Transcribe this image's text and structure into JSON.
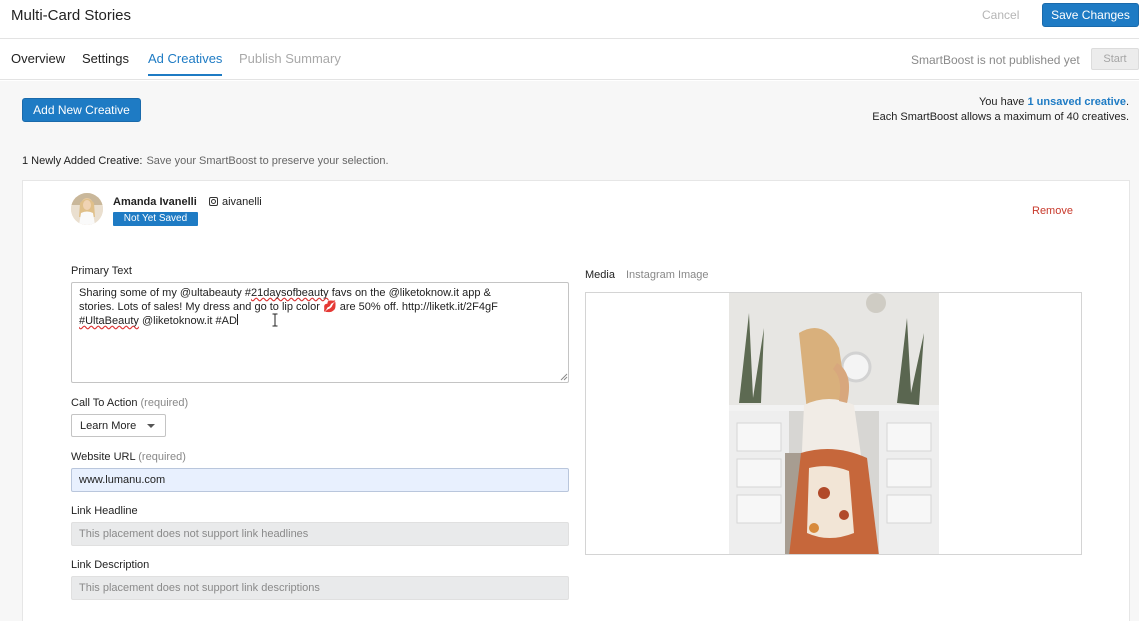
{
  "header": {
    "title": "Multi-Card Stories",
    "cancel_label": "Cancel",
    "save_label": "Save Changes"
  },
  "tabs": {
    "items": [
      {
        "label": "Overview"
      },
      {
        "label": "Settings"
      },
      {
        "label": "Ad Creatives"
      },
      {
        "label": "Publish Summary"
      }
    ],
    "active": "Ad Creatives",
    "status_text": "SmartBoost is not published yet",
    "start_label": "Start"
  },
  "toolbar": {
    "add_label": "Add New Creative",
    "unsaved_prefix": "You have ",
    "unsaved_link": "1 unsaved creative",
    "unsaved_suffix": ".",
    "max_text": "Each SmartBoost allows a maximum of 40 creatives."
  },
  "newly_added": {
    "label": "1 Newly Added Creative:",
    "hint": "Save your SmartBoost to preserve your selection."
  },
  "creative": {
    "author_name": "Amanda Ivanelli",
    "ig_handle": "aivanelli",
    "status": "Not Yet Saved",
    "remove_label": "Remove",
    "primary_text_label": "Primary Text",
    "primary_text": {
      "line1_a": "Sharing some of my @ultabeauty #",
      "line1_squig": "21daysofbeauty",
      "line1_b": " favs on the @liketoknow.it app &",
      "line2": "stories. Lots of sales! My dress and go to lip color 💋  are 50% off. http://liketk.it/2F4gF",
      "line3_squig": "#UltaBeauty",
      "line3_b": " @liketoknow.it #AD"
    },
    "cta_label": "Call To Action",
    "cta_required": "(required)",
    "cta_value": "Learn More",
    "url_label": "Website URL",
    "url_required": "(required)",
    "url_value": "www.lumanu.com",
    "headline_label": "Link Headline",
    "headline_placeholder": "This placement does not support link headlines",
    "description_label": "Link Description",
    "description_placeholder": "This placement does not support link descriptions",
    "media_label": "Media",
    "media_type": "Instagram Image"
  },
  "colors": {
    "accent": "#1e7bc4",
    "danger": "#c8392b",
    "url_fill": "#e8f0fe"
  }
}
